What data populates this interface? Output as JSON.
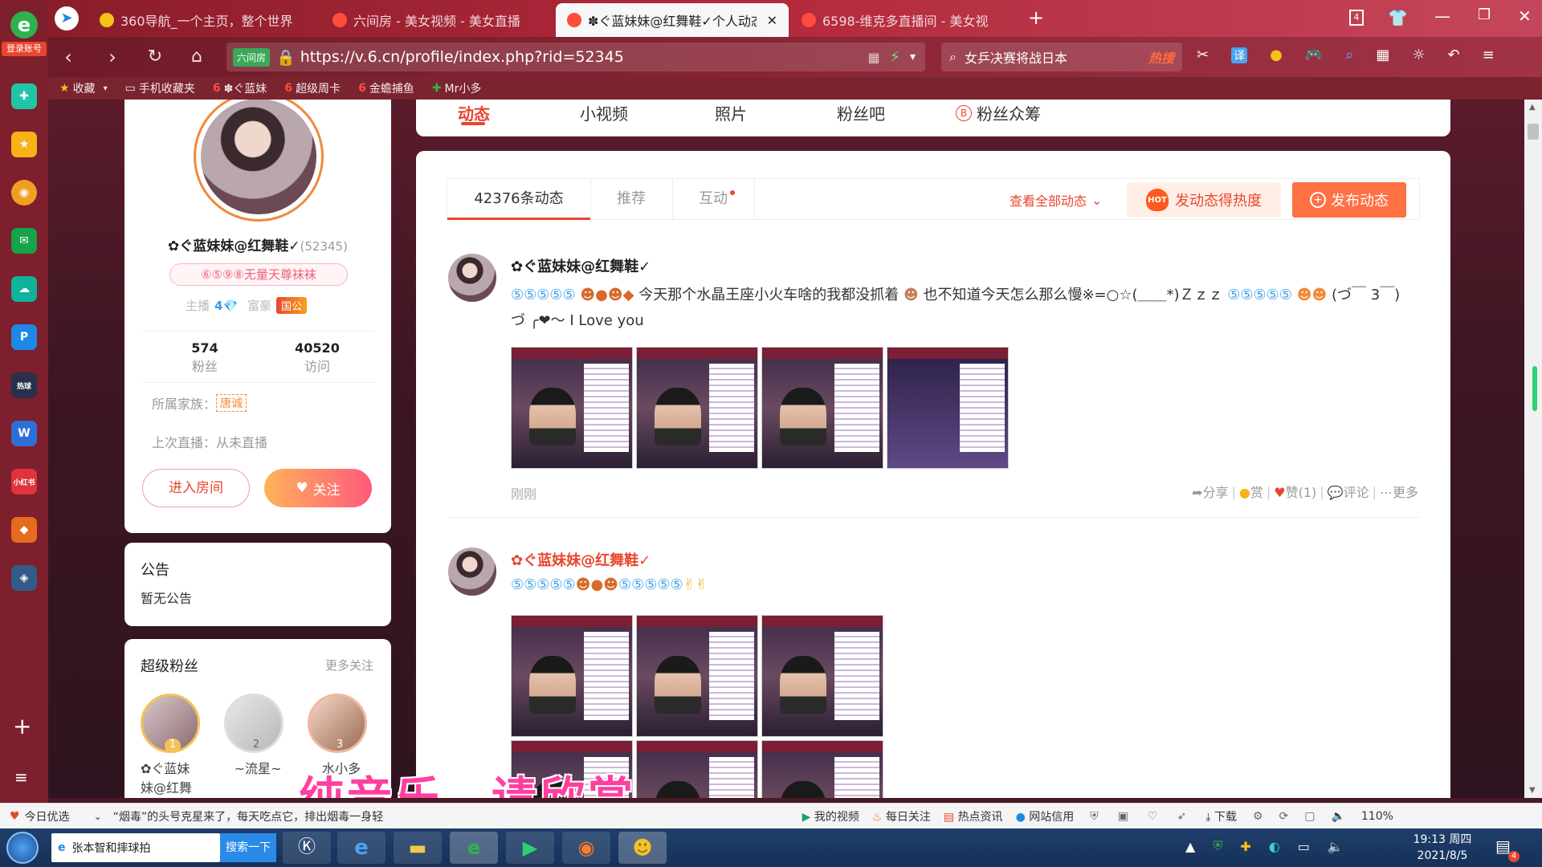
{
  "browser": {
    "login_badge": "登录账号",
    "tabs": [
      {
        "title": "360导航_一个主页，整个世界",
        "active": false
      },
      {
        "title": "六间房 - 美女视频 - 美女直播",
        "active": false
      },
      {
        "title": "✽ぐ蓝妹妹@红舞鞋✓个人动态",
        "active": true
      },
      {
        "title": "6598-维克多直播间 - 美女视",
        "active": false
      }
    ],
    "tab_count": "4",
    "security_badge": "六间房",
    "url": "https://v.6.cn/profile/index.php?rid=52345",
    "search_text": "女乒决赛将战日本",
    "hot_label": "热搜",
    "bookmarks": [
      "收藏",
      "手机收藏夹",
      "✽ぐ蓝妹",
      "超级周卡",
      "金蟾捕鱼",
      "Mr小多"
    ]
  },
  "profile": {
    "name": "✿ぐ蓝妹妹@红舞鞋✓",
    "rid": "(52345)",
    "badge": "⑥⑤⑨⑧无量天尊袜袜",
    "anchor_label": "主播",
    "anchor_level": "4",
    "rich_label": "富豪",
    "rich_level": "国公",
    "fans_count": "574",
    "fans_label": "粉丝",
    "visits_count": "40520",
    "visits_label": "访问",
    "family_label": "所属家族：",
    "family_value": "唐诚",
    "last_live": "上次直播：从未直播",
    "enter_room": "进入房间",
    "follow": "关注"
  },
  "notice": {
    "title": "公告",
    "body": "暂无公告"
  },
  "super_fans": {
    "title": "超级粉丝",
    "more": "更多关注",
    "fans": [
      {
        "rank": "1",
        "name": "✿ぐ蓝妹\n妹@红舞"
      },
      {
        "rank": "2",
        "name": "~流星~"
      },
      {
        "rank": "3",
        "name": "水小多"
      }
    ]
  },
  "top_tabs": [
    "动态",
    "小视频",
    "照片",
    "粉丝吧",
    "粉丝众筹"
  ],
  "feed_tabs": {
    "count_tab": "42376条动态",
    "recommend": "推荐",
    "interact": "互动",
    "view_all": "查看全部动态",
    "hot_button": "发动态得热度",
    "post_button": "发布动态"
  },
  "posts": [
    {
      "author": "✿ぐ蓝妹妹@红舞鞋✓",
      "text1": "今天那个水晶王座小火车啥的我都没抓着",
      "text2": "也不知道今天怎么那么慢※=○☆(＿＿*)Ｚｚｚ",
      "text3": "(づ￣ 3￣)づ ╭❤～ I  Love you",
      "time": "刚刚",
      "actions": {
        "share": "分享",
        "reward": "赏",
        "like": "赞(1)",
        "comment": "评论",
        "more": "更多"
      }
    },
    {
      "author": "✿ぐ蓝妹妹@红舞鞋✓",
      "time": ""
    }
  ],
  "overlay_caption": "纯音乐，请欣赏",
  "statusbar": {
    "today": "今日优选",
    "headline": "“烟毒”的头号克星来了，每天吃点它，排出烟毒一身轻",
    "items": [
      "我的视频",
      "每日关注",
      "热点资讯",
      "网站信用"
    ],
    "download": "下载",
    "zoom": "110%"
  },
  "taskbar": {
    "active_window": "张本智和摔球拍",
    "search_btn": "搜索一下",
    "time": "19:13 周四",
    "date": "2021/8/5",
    "notify_count": "4"
  },
  "colors": {
    "brand_red": "#e8462f",
    "accent_orange": "#ff7043",
    "tab_red": "#c5283a"
  }
}
